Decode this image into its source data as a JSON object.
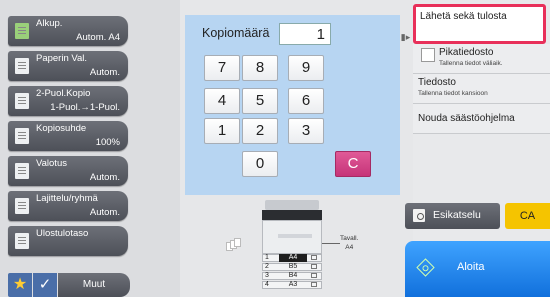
{
  "keypad": {
    "title": "Kopiomäärä",
    "value": "1",
    "keys": [
      "7",
      "8",
      "9",
      "4",
      "5",
      "6",
      "1",
      "2",
      "3",
      "0",
      "C"
    ]
  },
  "menu": [
    {
      "label": "Alkup.",
      "value": "Autom.  A4",
      "icon": "original-doc-icon"
    },
    {
      "label": "Paperin Val.",
      "value": "Autom.",
      "icon": "paper-icon"
    },
    {
      "label": "2-Puol.Kopio",
      "value": "1-Puol.→1-Puol.",
      "icon": "duplex-icon"
    },
    {
      "label": "Kopiosuhde",
      "value": "100%",
      "icon": "ratio-icon"
    },
    {
      "label": "Valotus",
      "value": "Autom.",
      "icon": "exposure-icon"
    },
    {
      "label": "Lajittelu/ryhmä",
      "value": "Autom.",
      "icon": "sort-icon"
    },
    {
      "label": "Ulostulotaso",
      "value": "",
      "icon": "output-tray-icon"
    }
  ],
  "bottom_bar": {
    "more_label": "Muut"
  },
  "right_panel": {
    "send_print": "Lähetä sekä tulosta",
    "quick_file": {
      "label": "Pikatiedosto",
      "sub": "Tallenna tiedot väliaik."
    },
    "file": {
      "label": "Tiedosto",
      "sub": "Tallenna tiedot kansioon"
    },
    "retrieve": "Nouda säästöohjelma",
    "preview": "Esikatselu",
    "ca": "CA",
    "start": "Aloita"
  },
  "machine": {
    "tray_label_1": "Tavall.",
    "tray_label_2": "A4",
    "trays": [
      {
        "num": "1",
        "size": "A4",
        "selected": true
      },
      {
        "num": "2",
        "size": "B5",
        "selected": false
      },
      {
        "num": "3",
        "size": "B4",
        "selected": false
      },
      {
        "num": "4",
        "size": "A3",
        "selected": false
      }
    ]
  },
  "colors": {
    "keypad_bg": "#b7d5f2",
    "highlight": "#e8305a",
    "clear_key": "#d03f85",
    "ca_button": "#f5c400",
    "start_button": "#1a80e8"
  }
}
